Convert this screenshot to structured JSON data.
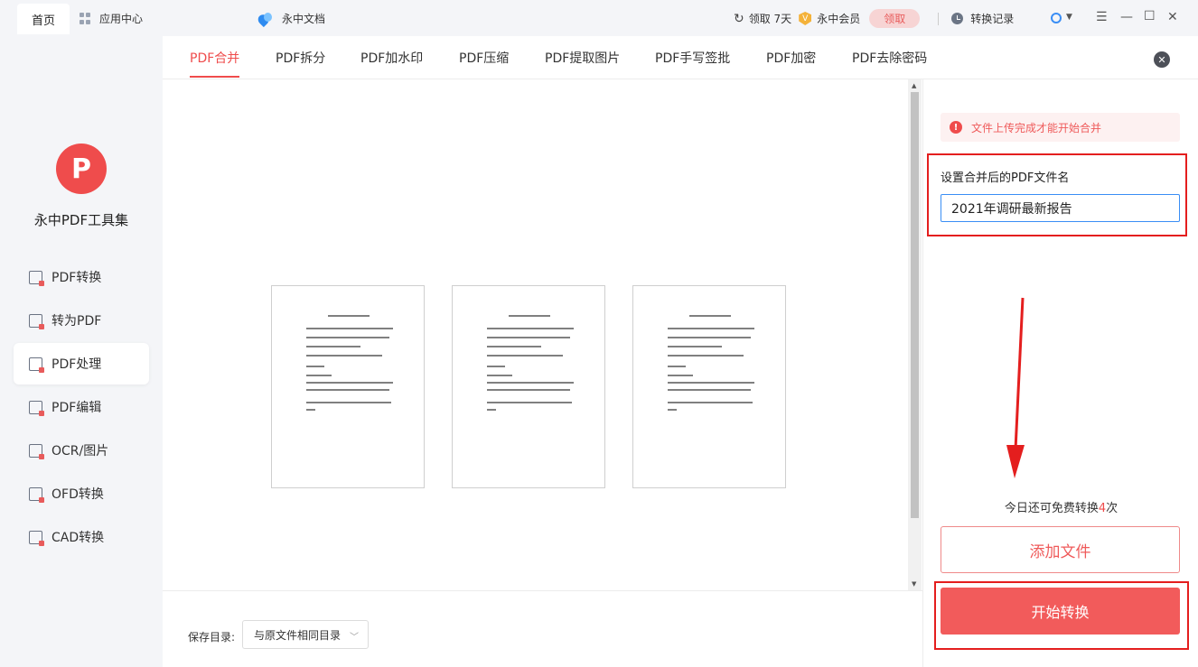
{
  "topbar": {
    "home_tab": "首页",
    "app_center": "应用中心",
    "doc_app": "永中文档",
    "claim_days": "领取 7天",
    "vip": "永中会员",
    "claim_button": "领取",
    "history": "转换记录"
  },
  "sidebar": {
    "logo_letter": "P",
    "app_title": "永中PDF工具集",
    "items": [
      {
        "label": "PDF转换"
      },
      {
        "label": "转为PDF"
      },
      {
        "label": "PDF处理"
      },
      {
        "label": "PDF编辑"
      },
      {
        "label": "OCR/图片"
      },
      {
        "label": "OFD转换"
      },
      {
        "label": "CAD转换"
      }
    ],
    "active_index": 2
  },
  "tabs": [
    "PDF合并",
    "PDF拆分",
    "PDF加水印",
    "PDF压缩",
    "PDF提取图片",
    "PDF手写签批",
    "PDF加密",
    "PDF去除密码"
  ],
  "active_tab": 0,
  "bottom": {
    "save_label": "保存目录:",
    "save_value": "与原文件相同目录"
  },
  "right_panel": {
    "notice": "文件上传完成才能开始合并",
    "name_label": "设置合并后的PDF文件名",
    "name_value": "2021年调研最新报告",
    "free_prefix": "今日还可免费转换",
    "free_num": "4",
    "free_suffix": "次",
    "add_button": "添加文件",
    "start_button": "开始转换"
  },
  "colors": {
    "accent": "#ef4c4c",
    "annotation_red": "#e41e1e",
    "input_border": "#3a8ef5"
  }
}
